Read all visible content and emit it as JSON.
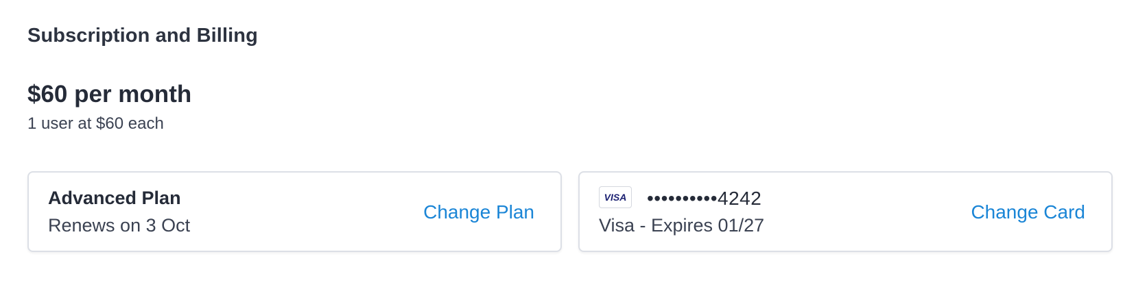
{
  "section": {
    "title": "Subscription and Billing"
  },
  "pricing": {
    "price": "$60 per month",
    "detail": "1 user at $60 each"
  },
  "plan_card": {
    "name": "Advanced Plan",
    "renewal": "Renews on 3 Oct",
    "action_label": "Change Plan"
  },
  "payment_card": {
    "brand_icon": "visa-icon",
    "brand_text": "VISA",
    "masked_number": "••••••••••4242",
    "expiry": "Visa - Expires 01/27",
    "action_label": "Change Card"
  },
  "colors": {
    "link": "#1a85d6",
    "text_primary": "#252b38",
    "text_secondary": "#3b4252",
    "card_border": "#dcdfe6",
    "visa_blue": "#1a1f71"
  }
}
